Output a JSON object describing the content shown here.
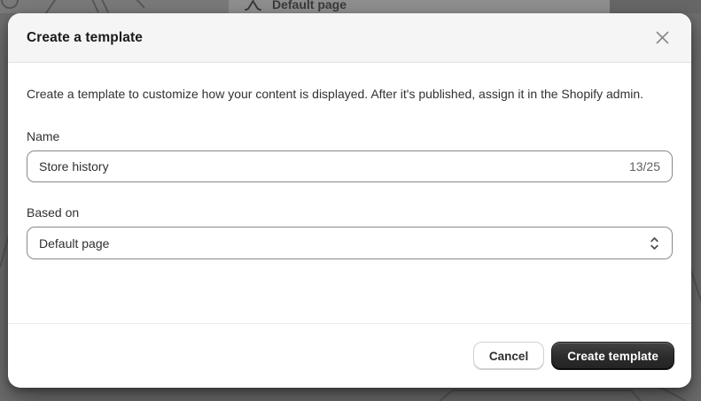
{
  "backdrop": {
    "menu_item": {
      "icon": "template-icon",
      "label": "Default page"
    }
  },
  "modal": {
    "title": "Create a template",
    "close_icon": "close-x",
    "description": "Create a template to customize how your content is displayed. After it's published, assign it in the Shopify admin.",
    "fields": {
      "name": {
        "label": "Name",
        "value": "Store history",
        "counter": "13/25"
      },
      "based_on": {
        "label": "Based on",
        "value": "Default page",
        "icon": "select-updown-chevron-icon"
      }
    },
    "footer": {
      "cancel_label": "Cancel",
      "submit_label": "Create template"
    }
  },
  "colors": {
    "scrim": "#6d6d6d",
    "header_bg": "#f5f5f5",
    "input_border": "#898989",
    "primary_button": "#2b2b2b",
    "counter_text": "#616161"
  }
}
